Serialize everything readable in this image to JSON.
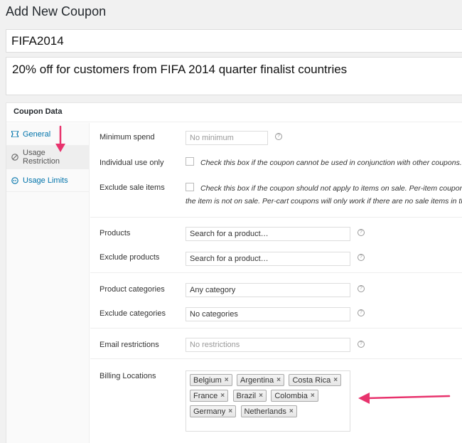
{
  "page": {
    "title": "Add New Coupon"
  },
  "coupon": {
    "code": "FIFA2014",
    "description": "20% off for customers from FIFA 2014 quarter finalist countries"
  },
  "coupon_data": {
    "heading": "Coupon Data",
    "tabs": [
      {
        "label": "General",
        "icon": "ticket-icon"
      },
      {
        "label": "Usage Restriction",
        "icon": "forbidden-icon"
      },
      {
        "label": "Usage Limits",
        "icon": "limits-icon"
      }
    ],
    "fields": {
      "min_spend": {
        "label": "Minimum spend",
        "placeholder": "No minimum"
      },
      "individual_use": {
        "label": "Individual use only",
        "description": "Check this box if the coupon cannot be used in conjunction with other coupons."
      },
      "exclude_sale": {
        "label": "Exclude sale items",
        "description_line1": "Check this box if the coupon should not apply to items on sale. Per-item coupons w",
        "description_line2": "the item is not on sale. Per-cart coupons will only work if there are no sale items in the ca"
      },
      "products": {
        "label": "Products",
        "placeholder": "Search for a product…"
      },
      "exclude_products": {
        "label": "Exclude products",
        "placeholder": "Search for a product…"
      },
      "product_categories": {
        "label": "Product categories",
        "value": "Any category"
      },
      "exclude_categories": {
        "label": "Exclude categories",
        "value": "No categories"
      },
      "email_restrictions": {
        "label": "Email restrictions",
        "placeholder": "No restrictions"
      },
      "billing_locations": {
        "label": "Billing Locations",
        "countries": [
          "Belgium",
          "Argentina",
          "Costa Rica",
          "France",
          "Brazil",
          "Colombia",
          "Germany",
          "Netherlands"
        ]
      }
    },
    "help_glyph": "?",
    "remove_glyph": "×"
  },
  "annotation_color": "#e8336d"
}
